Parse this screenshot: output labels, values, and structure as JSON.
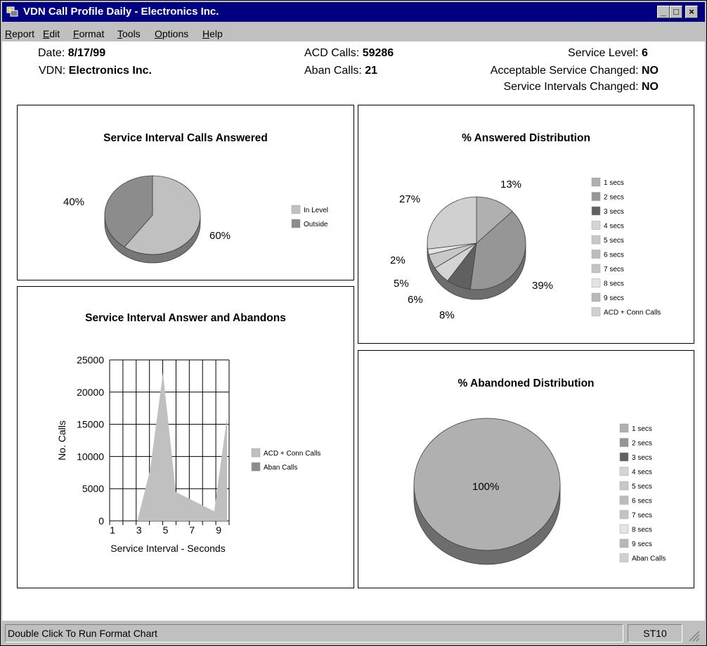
{
  "window": {
    "title": "VDN Call Profile Daily - Electronics Inc.",
    "buttons": {
      "minimize": "_",
      "maximize": "□",
      "close": "×"
    }
  },
  "menu": [
    {
      "label": "Report",
      "accel": "R",
      "rest": "eport"
    },
    {
      "label": "Edit",
      "accel": "E",
      "rest": "dit"
    },
    {
      "label": "Format",
      "accel": "F",
      "rest": "ormat"
    },
    {
      "label": "Tools",
      "accel": "T",
      "rest": "ools"
    },
    {
      "label": "Options",
      "accel": "O",
      "rest": "ptions"
    },
    {
      "label": "Help",
      "accel": "H",
      "rest": "elp"
    }
  ],
  "header": {
    "date_label": "Date:",
    "date_value": "8/17/99",
    "vdn_label": "VDN:",
    "vdn_value": "Electronics Inc.",
    "acd_label": "ACD Calls:",
    "acd_value": "59286",
    "aban_label": "Aban Calls:",
    "aban_value": "21",
    "service_level_label": "Service Level:",
    "service_level_value": "6",
    "acceptable_label": "Acceptable Service Changed:",
    "acceptable_value": "NO",
    "intervals_label": "Service Intervals Changed:",
    "intervals_value": "NO"
  },
  "chart_data": [
    {
      "type": "pie",
      "title": "Service Interval Calls Answered",
      "labels": [
        "In Level",
        "Outside"
      ],
      "values": [
        60,
        40
      ],
      "value_labels": [
        "60%",
        "40%"
      ],
      "colors": [
        "#c0c0c0",
        "#8c8c8c"
      ],
      "legend_position": "right"
    },
    {
      "type": "pie",
      "title": "% Answered Distribution",
      "labels": [
        "1 secs",
        "2 secs",
        "3 secs",
        "4 secs",
        "5 secs",
        "6 secs",
        "7 secs",
        "8 secs",
        "9 secs",
        "ACD + Conn Calls"
      ],
      "values": [
        13,
        39,
        8,
        6,
        5,
        0,
        0,
        2,
        0,
        27
      ],
      "value_labels": [
        "13%",
        "39%",
        "8%",
        "6%",
        "5%",
        "",
        "",
        "2%",
        "",
        "27%"
      ],
      "colors": [
        "#b0b0b0",
        "#969696",
        "#606060",
        "#d4d4d4",
        "#c8c8c8",
        "#bcbcbc",
        "#c4c4c4",
        "#e4e4e4",
        "#b8b8b8",
        "#d0d0d0"
      ],
      "legend_position": "right"
    },
    {
      "type": "area",
      "title": "Service Interval Answer and Abandons",
      "xlabel": "Service Interval - Seconds",
      "ylabel": "No. Calls",
      "ylim": [
        0,
        25000
      ],
      "yticks": [
        "25000",
        "20000",
        "15000",
        "10000",
        "5000",
        "0"
      ],
      "xticks": [
        "1",
        "3",
        "5",
        "7",
        "9"
      ],
      "x": [
        1,
        2,
        3,
        4,
        5,
        6,
        7,
        8,
        9,
        10
      ],
      "series": [
        {
          "name": "ACD + Conn Calls",
          "values": [
            0,
            0,
            0,
            8000,
            23000,
            4500,
            3500,
            2500,
            1500,
            16000
          ],
          "color": "#c0c0c0"
        },
        {
          "name": "Aban Calls",
          "values": [
            0,
            0,
            0,
            0,
            0,
            0,
            0,
            0,
            0,
            0
          ],
          "color": "#8c8c8c"
        }
      ],
      "grid": true,
      "legend_position": "right"
    },
    {
      "type": "pie",
      "title": "% Abandoned Distribution",
      "labels": [
        "1 secs",
        "2 secs",
        "3 secs",
        "4 secs",
        "5 secs",
        "6 secs",
        "7 secs",
        "8 secs",
        "9 secs",
        "Aban Calls"
      ],
      "values": [
        100,
        0,
        0,
        0,
        0,
        0,
        0,
        0,
        0,
        0
      ],
      "value_labels": [
        "100%"
      ],
      "colors": [
        "#b0b0b0",
        "#969696",
        "#606060",
        "#d4d4d4",
        "#c8c8c8",
        "#bcbcbc",
        "#c4c4c4",
        "#e4e4e4",
        "#b8b8b8",
        "#d0d0d0"
      ],
      "legend_position": "right"
    }
  ],
  "status": {
    "message": "Double Click To Run Format Chart",
    "code": "ST10"
  }
}
